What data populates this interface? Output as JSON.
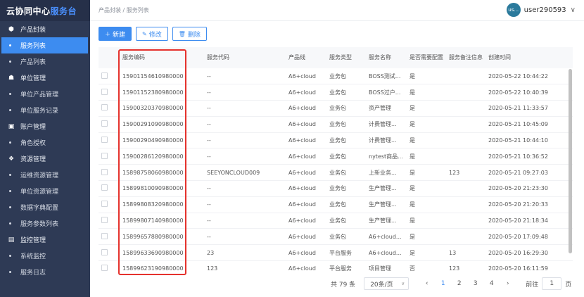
{
  "app": {
    "title_main": "云协同中心",
    "title_accent": "服务台"
  },
  "sidebar": {
    "items": [
      {
        "type": "group",
        "icon": "cube-icon",
        "glyph": "⬢",
        "label": "产品封装"
      },
      {
        "type": "item",
        "label": "服务列表",
        "active": true
      },
      {
        "type": "item",
        "label": "产品列表"
      },
      {
        "type": "group",
        "icon": "users-icon",
        "glyph": "☗",
        "label": "单位管理"
      },
      {
        "type": "item",
        "label": "单位产品管理"
      },
      {
        "type": "item",
        "label": "单位服务记录"
      },
      {
        "type": "group",
        "icon": "account-icon",
        "glyph": "▣",
        "label": "账户管理"
      },
      {
        "type": "item",
        "label": "角色授权"
      },
      {
        "type": "group",
        "icon": "resource-icon",
        "glyph": "❖",
        "label": "资源管理"
      },
      {
        "type": "item",
        "label": "运维资源管理"
      },
      {
        "type": "item",
        "label": "单位资源管理"
      },
      {
        "type": "item",
        "label": "数据字典配置"
      },
      {
        "type": "item",
        "label": "服务参数列表"
      },
      {
        "type": "group",
        "icon": "monitor-icon",
        "glyph": "▤",
        "label": "监控管理"
      },
      {
        "type": "item",
        "label": "系统监控"
      },
      {
        "type": "item",
        "label": "服务日志"
      }
    ]
  },
  "header": {
    "breadcrumb": "产品封装 / 服务列表",
    "avatar_text": "us...",
    "username": "user290593"
  },
  "toolbar": {
    "new_label": "新建",
    "edit_label": "修改",
    "delete_label": "删除"
  },
  "table": {
    "columns": [
      "",
      "服务编码",
      "服务代码",
      "产品线",
      "服务类型",
      "服务名称",
      "是否需要配置",
      "服务备注信息",
      "创建时间"
    ],
    "rows": [
      [
        "1590115461 0980000",
        "--",
        "A6+cloud",
        "业务包",
        "BOSS测试...",
        "是",
        "",
        "2020-05-22 10:44:22"
      ],
      [
        "1590115238 0980000",
        "--",
        "A6+cloud",
        "业务包",
        "BOSS过户...",
        "是",
        "",
        "2020-05-22 10:40:39"
      ],
      [
        "1590032037 0980000",
        "--",
        "A6+cloud",
        "业务包",
        "资产管理",
        "是",
        "",
        "2020-05-21 11:33:57"
      ],
      [
        "1590029109 0980000",
        "--",
        "A6+cloud",
        "业务包",
        "计费管理...",
        "是",
        "",
        "2020-05-21 10:45:09"
      ],
      [
        "1590029049 0980000",
        "--",
        "A6+cloud",
        "业务包",
        "计费管理...",
        "是",
        "",
        "2020-05-21 10:44:10"
      ],
      [
        "1590028612 0980000",
        "--",
        "A6+cloud",
        "业务包",
        "nytest商品...",
        "是",
        "",
        "2020-05-21 10:36:52"
      ],
      [
        "1589875806 0980000",
        "SEEYONCLOUD009",
        "A6+cloud",
        "业务包",
        "上新业务...",
        "是",
        "123",
        "2020-05-21 09:27:03"
      ],
      [
        "1589981009 0980000",
        "--",
        "A6+cloud",
        "业务包",
        "生产管理...",
        "是",
        "",
        "2020-05-20 21:23:30"
      ],
      [
        "1589980832 0980000",
        "--",
        "A6+cloud",
        "业务包",
        "生产管理...",
        "是",
        "",
        "2020-05-20 21:20:33"
      ],
      [
        "1589980714 0980000",
        "--",
        "A6+cloud",
        "业务包",
        "生产管理...",
        "是",
        "",
        "2020-05-20 21:18:34"
      ],
      [
        "1589965788 0980000",
        "--",
        "A6+cloud",
        "业务包",
        "A6+cloud...",
        "是",
        "",
        "2020-05-20 17:09:48"
      ],
      [
        "1589963369 0980000",
        "23",
        "A6+cloud",
        "平台服务",
        "A6+cloud...",
        "是",
        "13",
        "2020-05-20 16:29:30"
      ],
      [
        "1589962319 0980000",
        "123",
        "A6+cloud",
        "平台服务",
        "项目管理",
        "否",
        "123",
        "2020-05-20 16:11:59"
      ]
    ]
  },
  "pagination": {
    "total_text": "共 79 条",
    "page_size": "20条/页",
    "prev": "‹",
    "pages": [
      "1",
      "2",
      "3",
      "4"
    ],
    "current": "1",
    "next": "›",
    "goto_label": "前往",
    "goto_value": "1",
    "page_suffix": "页"
  }
}
